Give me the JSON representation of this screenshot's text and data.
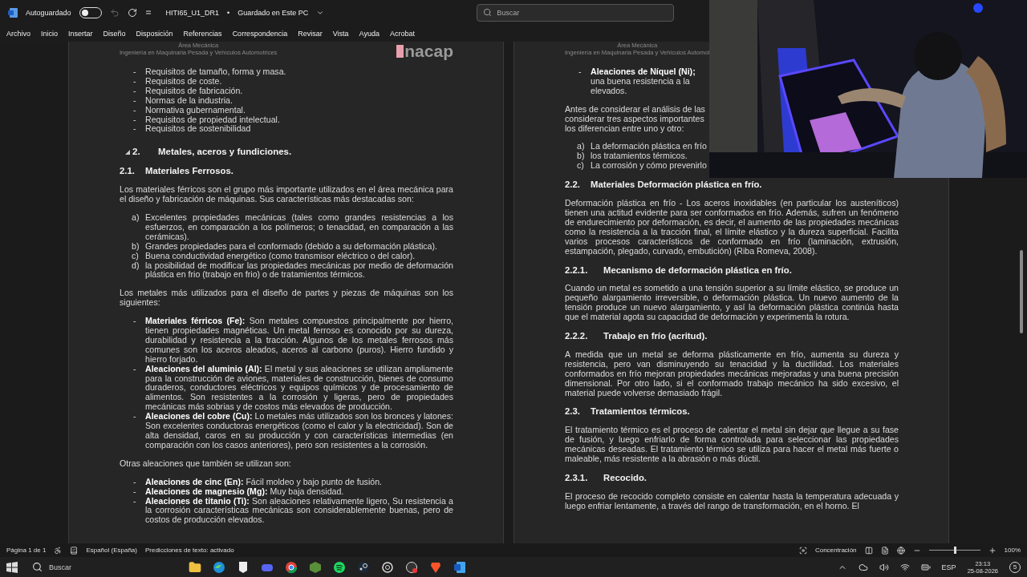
{
  "title_bar": {
    "autosave_label": "Autoguardado",
    "autosave_on": false,
    "document_title": "HITI65_U1_DR1",
    "separator": "•",
    "save_status": "Guardado en Este PC",
    "search_placeholder": "Buscar"
  },
  "menu": [
    "Archivo",
    "Inicio",
    "Insertar",
    "Diseño",
    "Disposición",
    "Referencias",
    "Correspondencia",
    "Revisar",
    "Vista",
    "Ayuda",
    "Acrobat"
  ],
  "pages": [
    {
      "header_area": "Área Mecánica",
      "header_program": "Ingeniería en Maquinaria Pesada y Vehículos Automotrices",
      "logo": "nacap",
      "blocks": [
        {
          "kind": "bullet",
          "marker": "-",
          "text": "Requisitos de tamaño, forma y masa."
        },
        {
          "kind": "bullet",
          "marker": "-",
          "text": "Requisitos de coste."
        },
        {
          "kind": "bullet",
          "marker": "-",
          "text": "Requisitos de fabricación."
        },
        {
          "kind": "bullet",
          "marker": "-",
          "text": "Normas de la industria."
        },
        {
          "kind": "bullet",
          "marker": "-",
          "text": "Normativa gubernamental."
        },
        {
          "kind": "bullet",
          "marker": "-",
          "text": "Requisitos de propiedad intelectual."
        },
        {
          "kind": "bullet",
          "marker": "-",
          "text": "Requisitos de sostenibilidad"
        },
        {
          "kind": "heading1",
          "number": "2.",
          "text": "Metales, aceros y fundiciones.",
          "expanded": true
        },
        {
          "kind": "heading2",
          "number": "2.1.",
          "text": "Materiales Ferrosos."
        },
        {
          "kind": "paragraph",
          "text": "Los materiales férricos son el grupo más importante utilizados en el área mecánica para el diseño y fabricación de máquinas. Sus características más destacadas son:"
        },
        {
          "kind": "lettered",
          "marker": "a)",
          "text": "Excelentes propiedades mecánicas (tales como grandes resistencias a los esfuerzos, en comparación a los polímeros; o tenacidad, en comparación a las cerámicas)."
        },
        {
          "kind": "lettered",
          "marker": "b)",
          "text": "Grandes propiedades para el conformado (debido a su deformación plástica)."
        },
        {
          "kind": "lettered",
          "marker": "c)",
          "text": "Buena conductividad energético (como transmisor eléctrico o del calor)."
        },
        {
          "kind": "lettered",
          "marker": "d)",
          "text": "la posibilidad de modificar las propiedades mecánicas por medio de deformación plástica en frio (trabajo en frio) o de tratamientos térmicos."
        },
        {
          "kind": "paragraph",
          "text": "Los metales más utilizados para el diseño de partes y piezas de máquinas son los siguientes:"
        },
        {
          "kind": "bullet",
          "marker": "-",
          "text": "**Materiales férricos (Fe):** Son metales compuestos principalmente por hierro, tienen propiedades magnéticas. Un metal ferroso es conocido por su dureza, durabilidad y resistencia a la tracción. Algunos de los metales ferrosos más comunes son los aceros aleados, aceros al carbono (puros). Hierro fundido y hierro forjado."
        },
        {
          "kind": "bullet",
          "marker": "-",
          "text": "**Aleaciones del aluminio (Al):** El metal y sus aleaciones se utilizan ampliamente para la construcción de aviones, materiales de construcción, bienes de consumo duraderos, conductores eléctricos y equipos químicos y de procesamiento de alimentos. Son resistentes a la corrosión y ligeras, pero de propiedades mecánicas más sobrias y de costos más elevados de producción."
        },
        {
          "kind": "bullet",
          "marker": "-",
          "text": "**Aleaciones del cobre (Cu):** Lo metales más utilizados son los bronces y latones: Son excelentes conductoras energéticos (como el calor y la electricidad). Son de alta densidad, caros en su producción y con características intermedias (en comparación con los casos anteriores), pero son resistentes a la corrosión."
        },
        {
          "kind": "paragraph",
          "text": "Otras aleaciones que también se utilizan son:"
        },
        {
          "kind": "bullet",
          "marker": "-",
          "text": "**Aleaciones de cinc (En):** Fácil moldeo y bajo punto de fusión."
        },
        {
          "kind": "bullet",
          "marker": "-",
          "text": "**Aleaciones de magnesio (Mg):** Muy baja densidad."
        },
        {
          "kind": "bullet",
          "marker": "-",
          "text": "**Aleaciones de titanio (Ti):** Son aleaciones relativamente ligero, Su resistencia a la corrosión características mecánicas son considerablemente buenas, pero de costos de producción elevados."
        }
      ]
    },
    {
      "header_area": "Área Mecánica",
      "header_program": "Ingeniería en Maquinaria Pesada y Vehículos Automot",
      "blocks": [
        {
          "kind": "bullet",
          "marker": "-",
          "lines": [
            "**Aleaciones de Níquel (Ni);**",
            "una buena resistencia a la",
            "elevados."
          ]
        },
        {
          "kind": "paragraph",
          "lines": [
            "Antes de considerar el análisis de las",
            "considerar tres aspectos importantes",
            "los diferencian entre uno y otro:"
          ]
        },
        {
          "kind": "lettered",
          "marker": "a)",
          "lines": [
            "La deformación plástica en frío"
          ]
        },
        {
          "kind": "lettered",
          "marker": "b)",
          "text": "los tratamientos térmicos."
        },
        {
          "kind": "lettered",
          "marker": "c)",
          "lines": [
            "La corrosión y cómo prevenirlo"
          ]
        },
        {
          "kind": "heading2",
          "number": "2.2.",
          "text": "Materiales Deformación plástica en frío."
        },
        {
          "kind": "paragraph",
          "text": "Deformación plástica en frío - Los aceros inoxidables (en particular los austeníticos) tienen una actitud evidente para ser conformados en frío. Además, sufren un fenómeno de endurecimiento por deformación, es decir, el aumento de las propiedades mecánicas como la resistencia a la tracción final, el límite elástico y la dureza superficial. Facilita varios procesos característicos de conformado en frío (laminación, extrusión, estampación, plegado, curvado, embutición) (Riba Romeva, 2008)."
        },
        {
          "kind": "heading3",
          "number": "2.2.1.",
          "text": "Mecanismo de deformación plástica en frío."
        },
        {
          "kind": "paragraph",
          "text": "Cuando un metal es sometido a una tensión superior a su límite elástico, se produce un pequeño alargamiento irreversible, o deformación plástica. Un nuevo aumento de la tensión produce un nuevo alargamiento, y así la deformación plástica continúa hasta que el material agota su capacidad de deformación y experimenta la rotura."
        },
        {
          "kind": "heading3",
          "number": "2.2.2.",
          "text": "Trabajo en frío (acritud)."
        },
        {
          "kind": "paragraph",
          "text": "A medida que un metal se deforma plásticamente en frío, aumenta su dureza y resistencia, pero van disminuyendo su tenacidad y la ductilidad. Los materiales conformados en frío mejoran propiedades mecánicas mejoradas y una buena precisión dimensional. Por otro lado, si el conformado trabajo mecánico ha sido excesivo, el material puede volverse demasiado frágil."
        },
        {
          "kind": "heading2",
          "number": "2.3.",
          "text": "Tratamientos térmicos."
        },
        {
          "kind": "paragraph",
          "text": "El tratamiento térmico es el proceso de calentar el metal sin dejar que llegue a su fase de fusión, y luego enfriarlo de forma controlada para seleccionar las propiedades mecánicas deseadas. El tratamiento térmico se utiliza para hacer el metal más fuerte o maleable, más resistente a la abrasión o más dúctil."
        },
        {
          "kind": "heading3",
          "number": "2.3.1.",
          "text": "Recocido."
        },
        {
          "kind": "paragraph",
          "text": "El proceso de recocido completo consiste en calentar hasta la temperatura adecuada y luego enfriar lentamente, a través del rango de transformación, en el horno. El"
        }
      ]
    }
  ],
  "status_bar": {
    "page": "Página 1 de 1",
    "language": "Español (España)",
    "predictions": "Predicciones de texto: activado",
    "focus": "Concentración",
    "zoom": {
      "level": 0.5,
      "reading": "100%"
    }
  },
  "taskbar": {
    "search": "Buscar",
    "language": "ESP",
    "time": "23:13",
    "date": "25-08-2026",
    "notifications": "5"
  }
}
